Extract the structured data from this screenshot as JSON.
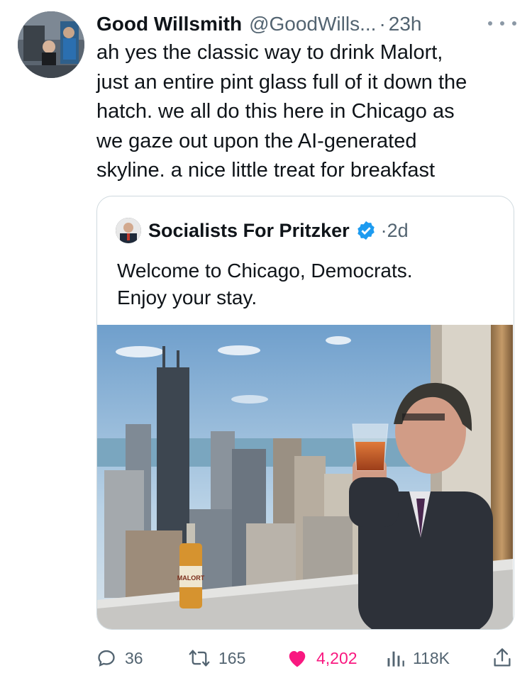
{
  "tweet": {
    "author_name": "Good Willsmith",
    "author_handle": "@GoodWills...",
    "separator": "·",
    "time": "23h",
    "text": "ah yes the classic way to drink Malort,\njust an entire pint glass full of it down the\nhatch. we all do this here in Chicago as\nwe gaze out upon the AI-generated\nskyline. a nice little treat for breakfast"
  },
  "quoted": {
    "author_name": "Socialists For Pritzker",
    "separator": "·",
    "time": "2d",
    "text": "Welcome to Chicago, Democrats.\nEnjoy your stay.",
    "image_bottle_label": "MALORT"
  },
  "actions": {
    "replies": "36",
    "retweets": "165",
    "likes": "4,202",
    "views": "118K"
  },
  "colors": {
    "like": "#f91880",
    "verified": "#1d9bf0",
    "muted": "#536471",
    "border": "#cfd9de"
  },
  "icons": [
    "more-icon",
    "verified-icon",
    "reply-icon",
    "retweet-icon",
    "like-icon",
    "views-icon",
    "share-icon"
  ]
}
